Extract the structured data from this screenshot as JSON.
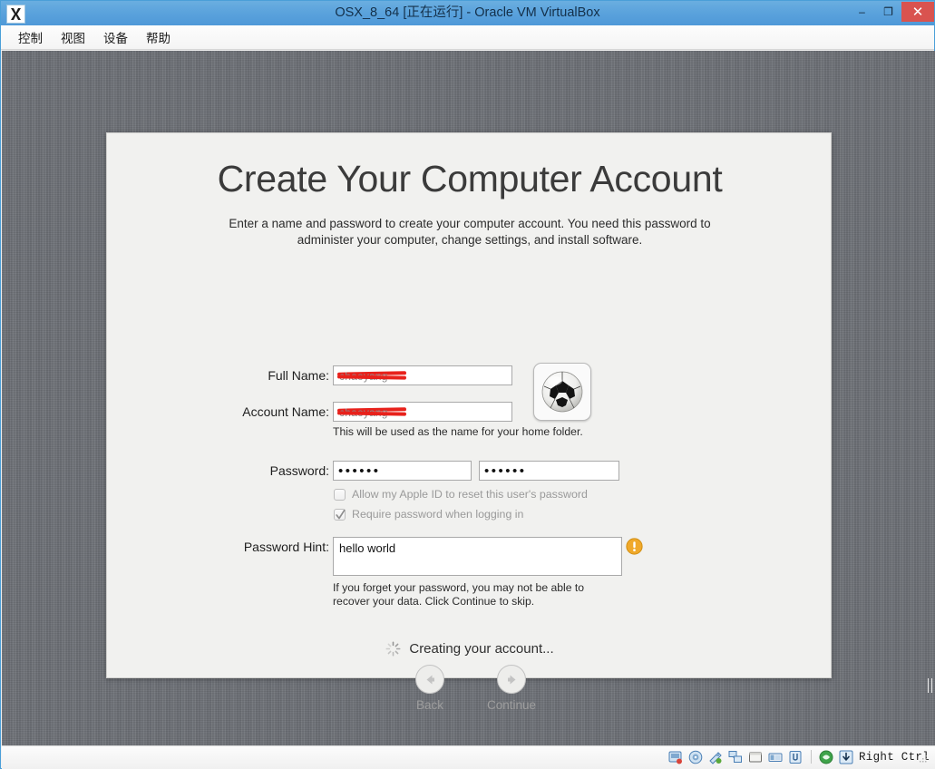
{
  "window": {
    "title": "OSX_8_64 [正在运行] - Oracle VM VirtualBox",
    "app_icon": "virtualbox-osx-icon",
    "controls": {
      "minimize_label": "–",
      "maximize_label": "❐",
      "close_label": "✕"
    },
    "close_button_color": "#d9534f",
    "titlebar_color": "#5aa2dc"
  },
  "menubar": {
    "items": [
      {
        "label": "控制",
        "name": "menu-control"
      },
      {
        "label": "视图",
        "name": "menu-view"
      },
      {
        "label": "设备",
        "name": "menu-devices"
      },
      {
        "label": "帮助",
        "name": "menu-help"
      }
    ]
  },
  "guest": {
    "background_color": "#6d7076"
  },
  "installer": {
    "heading": "Create Your Computer Account",
    "subtitle": "Enter a name and password to create your computer account. You need this password to administer your computer, change settings, and install software.",
    "fields": {
      "full_name": {
        "label": "Full Name:",
        "value": "",
        "redacted": true,
        "redacted_ghost": "chaoyang"
      },
      "account_name": {
        "label": "Account Name:",
        "value": "",
        "redacted": true,
        "redacted_ghost": "chaoyang"
      },
      "password": {
        "label": "Password:",
        "value": "••••••"
      },
      "verify": {
        "value": "••••••"
      },
      "password_hint": {
        "label": "Password Hint:",
        "value": "hello world"
      }
    },
    "helper_home_folder": "This will be used as the name for your home folder.",
    "helper_hint": "If you forget your password, you may not be able to recover your data. Click Continue to skip.",
    "checkboxes": [
      {
        "label": "Allow my Apple ID to reset this user's password",
        "checked": false,
        "name": "checkbox-apple-id-reset"
      },
      {
        "label": "Require password when logging in",
        "checked": true,
        "name": "checkbox-require-password"
      }
    ],
    "avatar": {
      "icon": "soccer-ball-avatar"
    },
    "warning_icon": {
      "name": "warning-exclamation-icon",
      "color": "#e8a31e"
    },
    "status": {
      "text": "Creating your account...",
      "spinner": "loading-spinner-icon"
    },
    "buttons": {
      "back": {
        "label": "Back",
        "icon": "arrow-left-icon",
        "enabled": false
      },
      "continue": {
        "label": "Continue",
        "icon": "arrow-right-icon",
        "enabled": false
      }
    }
  },
  "statusbar": {
    "icons": [
      {
        "name": "hard-disk-icon"
      },
      {
        "name": "optical-disk-icon"
      },
      {
        "name": "floppy-disk-icon"
      },
      {
        "name": "network-adapter-icon"
      },
      {
        "name": "shared-folders-icon"
      },
      {
        "name": "display-icon"
      },
      {
        "name": "usb-icon"
      },
      {
        "name": "video-capture-icon"
      },
      {
        "name": "host-key-icon"
      }
    ],
    "host_key_label": "Right Ctrl"
  }
}
